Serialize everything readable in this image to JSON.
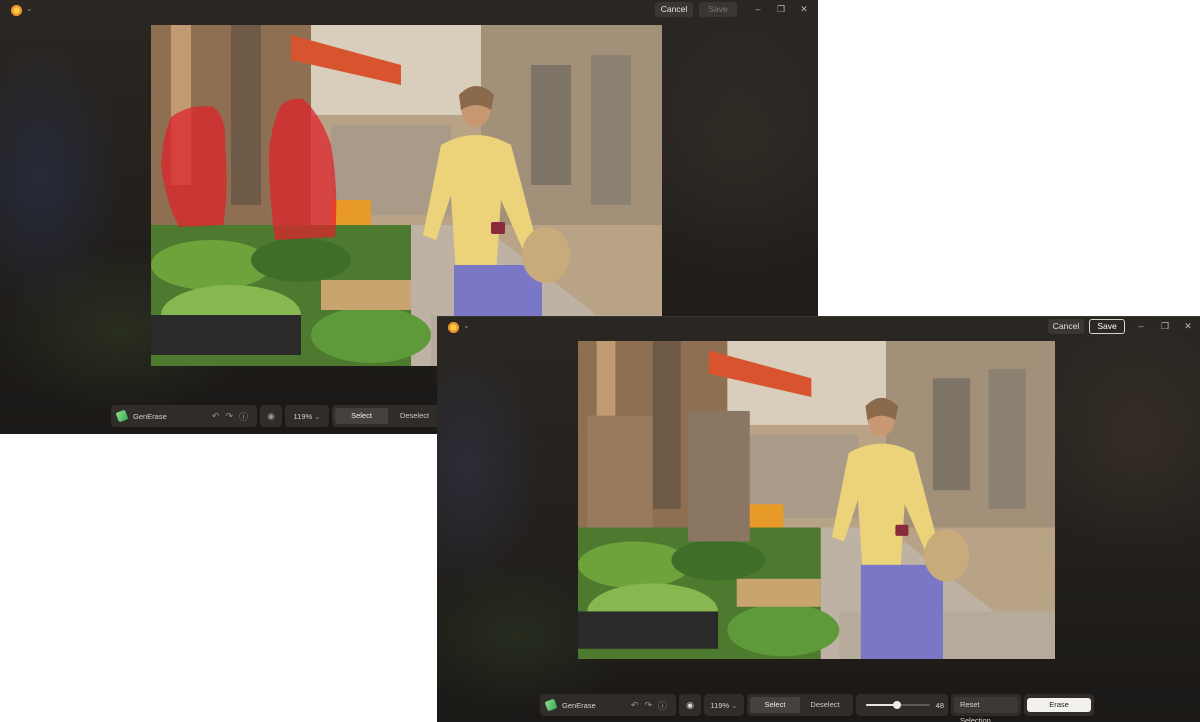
{
  "back_window": {
    "title_buttons": {
      "cancel": "Cancel",
      "save": "Save"
    },
    "toolbar": {
      "tool_name": "GenErase",
      "zoom": "119%",
      "mode_select": "Select",
      "mode_deselect": "Deselect"
    }
  },
  "front_window": {
    "title_buttons": {
      "cancel": "Cancel",
      "save": "Save"
    },
    "toolbar": {
      "tool_name": "GenErase",
      "zoom": "119%",
      "mode_select": "Select",
      "mode_deselect": "Deselect",
      "brush_size": "48",
      "brush_size_fraction": 0.48,
      "reset_selection": "Reset Selection",
      "erase": "Erase"
    }
  },
  "icons": {
    "app": "app-logo-icon",
    "undo": "undo-icon",
    "redo": "redo-icon",
    "info": "info-icon",
    "eye": "eye-icon",
    "minimize": "minimize-icon",
    "restore": "restore-icon",
    "close": "close-icon"
  },
  "colors": {
    "selection_overlay": "#e0202a",
    "background": "#1d1b19",
    "toolbar": "#2f2c29"
  }
}
